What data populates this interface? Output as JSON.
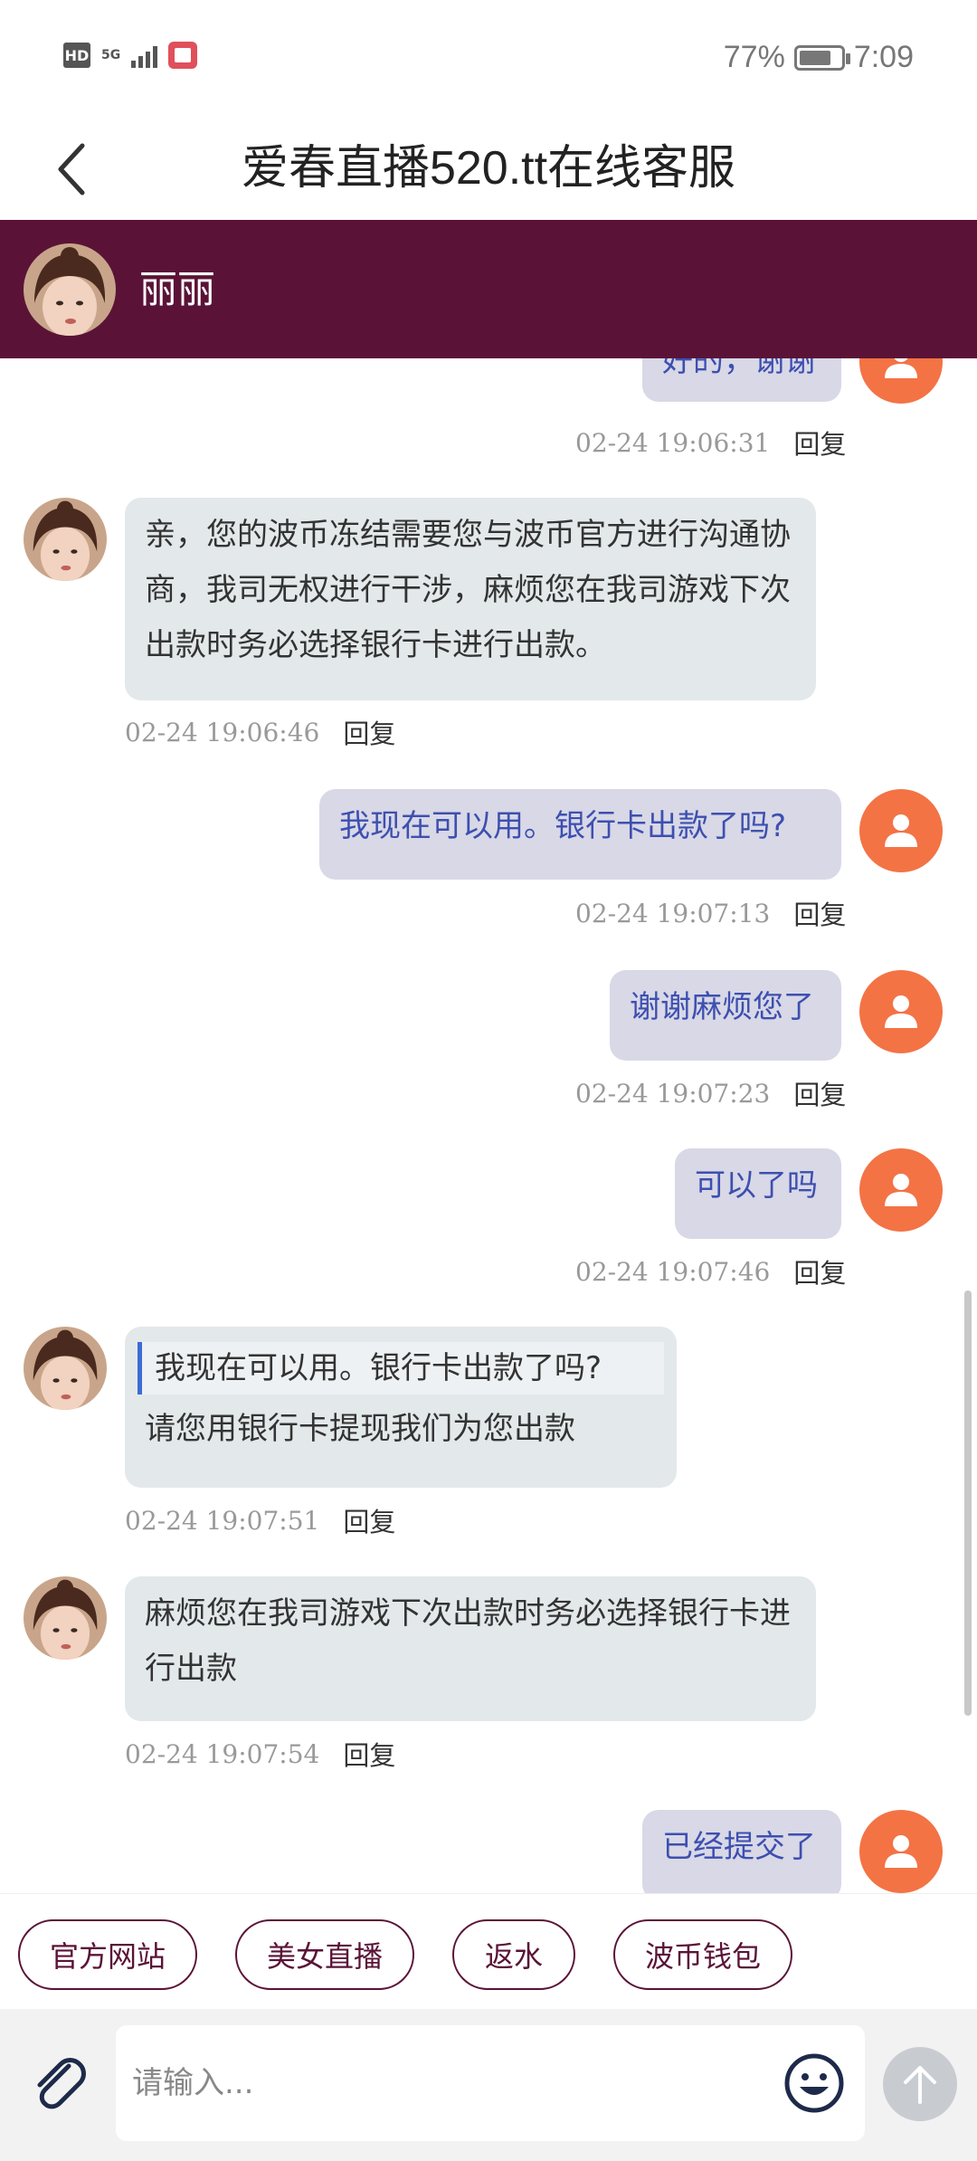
{
  "status_bar": {
    "hd": "HD",
    "network": "5G",
    "battery": "77%",
    "battery_level": 0.77,
    "time": "7:09"
  },
  "header": {
    "title": "爱春直播520.tt在线客服",
    "back_icon": "chevron-left-icon"
  },
  "agent": {
    "name": "丽丽",
    "header_color": "#5a1337"
  },
  "messages": [
    {
      "from": "user",
      "text": "好的，谢谢",
      "time": "02-24 19:06:31",
      "reply": "回复"
    },
    {
      "from": "agent",
      "text": "亲，您的波币冻结需要您与波币官方进行沟通协商，我司无权进行干涉，麻烦您在我司游戏下次出款时务必选择银行卡进行出款。",
      "time": "02-24 19:06:46",
      "reply": "回复"
    },
    {
      "from": "user",
      "text": "我现在可以用。银行卡出款了吗?",
      "time": "02-24 19:07:13",
      "reply": "回复"
    },
    {
      "from": "user",
      "text": "谢谢麻烦您了",
      "time": "02-24 19:07:23",
      "reply": "回复"
    },
    {
      "from": "user",
      "text": "可以了吗",
      "time": "02-24 19:07:46",
      "reply": "回复"
    },
    {
      "from": "agent",
      "quote": "我现在可以用。银行卡出款了吗?",
      "text": "请您用银行卡提现我们为您出款",
      "time": "02-24 19:07:51",
      "reply": "回复"
    },
    {
      "from": "agent",
      "text": "麻烦您在我司游戏下次出款时务必选择银行卡进行出款",
      "time": "02-24 19:07:54",
      "reply": "回复"
    },
    {
      "from": "user",
      "text": "已经提交了"
    }
  ],
  "quick_replies": [
    "官方网站",
    "美女直播",
    "返水",
    "波币钱包"
  ],
  "input": {
    "placeholder": "请输入...",
    "value": ""
  },
  "colors": {
    "accent": "#5a1337",
    "user_avatar": "#f37345",
    "user_text": "#3d4fb0"
  }
}
